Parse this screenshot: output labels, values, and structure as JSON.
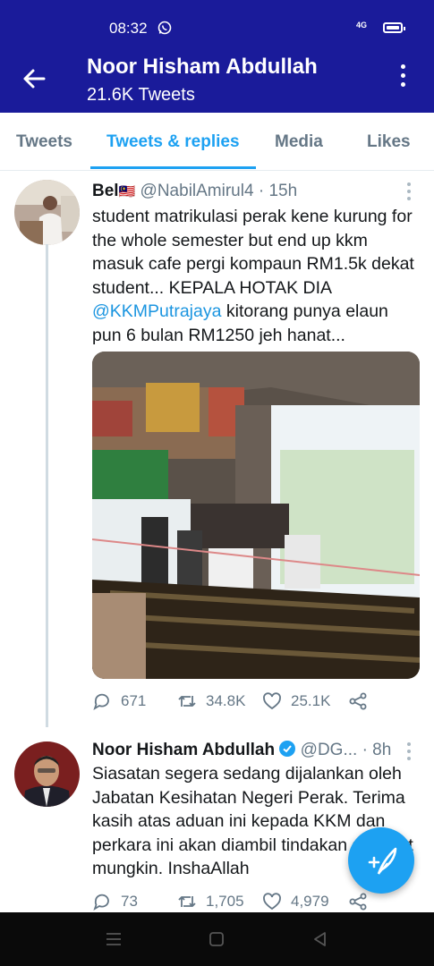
{
  "status_bar": {
    "time": "08:32",
    "network": "4G"
  },
  "header": {
    "title": "Noor Hisham Abdullah",
    "subtitle": "21.6K Tweets"
  },
  "tabs": [
    {
      "label": "Tweets"
    },
    {
      "label": "Tweets & replies",
      "active": true
    },
    {
      "label": "Media"
    },
    {
      "label": "Likes"
    }
  ],
  "tweets": [
    {
      "name": "Bel",
      "flag": "🇲🇾",
      "handle": "@NabilAmirul4",
      "sep": "·",
      "time": "15h",
      "text_before": "student matrikulasi perak kene kurung for the whole semester but end up kkm masuk cafe pergi kompaun RM1.5k dekat student... KEPALA HOTAK DIA ",
      "mention": "@KKMPutrajaya",
      "text_after": " kitorang punya elaun pun 6 bulan RM1250 jeh hanat...",
      "replies": "671",
      "retweets": "34.8K",
      "likes": "25.1K"
    },
    {
      "name": "Noor Hisham Abdullah",
      "handle": "@DG...",
      "sep": "·",
      "time": "8h",
      "text": "Siasatan segera sedang dijalankan oleh Jabatan Kesihatan Negeri Perak. Terima kasih atas aduan ini kepada KKM dan perkara ini akan diambil tindakan secepat mungkin. InshaAllah",
      "replies": "73",
      "retweets": "1,705",
      "likes": "4,979"
    }
  ],
  "colors": {
    "appbar": "#1a1b9a",
    "accent": "#1da1f2",
    "muted": "#657786"
  },
  "icons": [
    "back-arrow-icon",
    "more-vertical-icon",
    "reply-icon",
    "retweet-icon",
    "like-icon",
    "share-icon",
    "compose-icon",
    "whatsapp-icon",
    "battery-icon"
  ]
}
